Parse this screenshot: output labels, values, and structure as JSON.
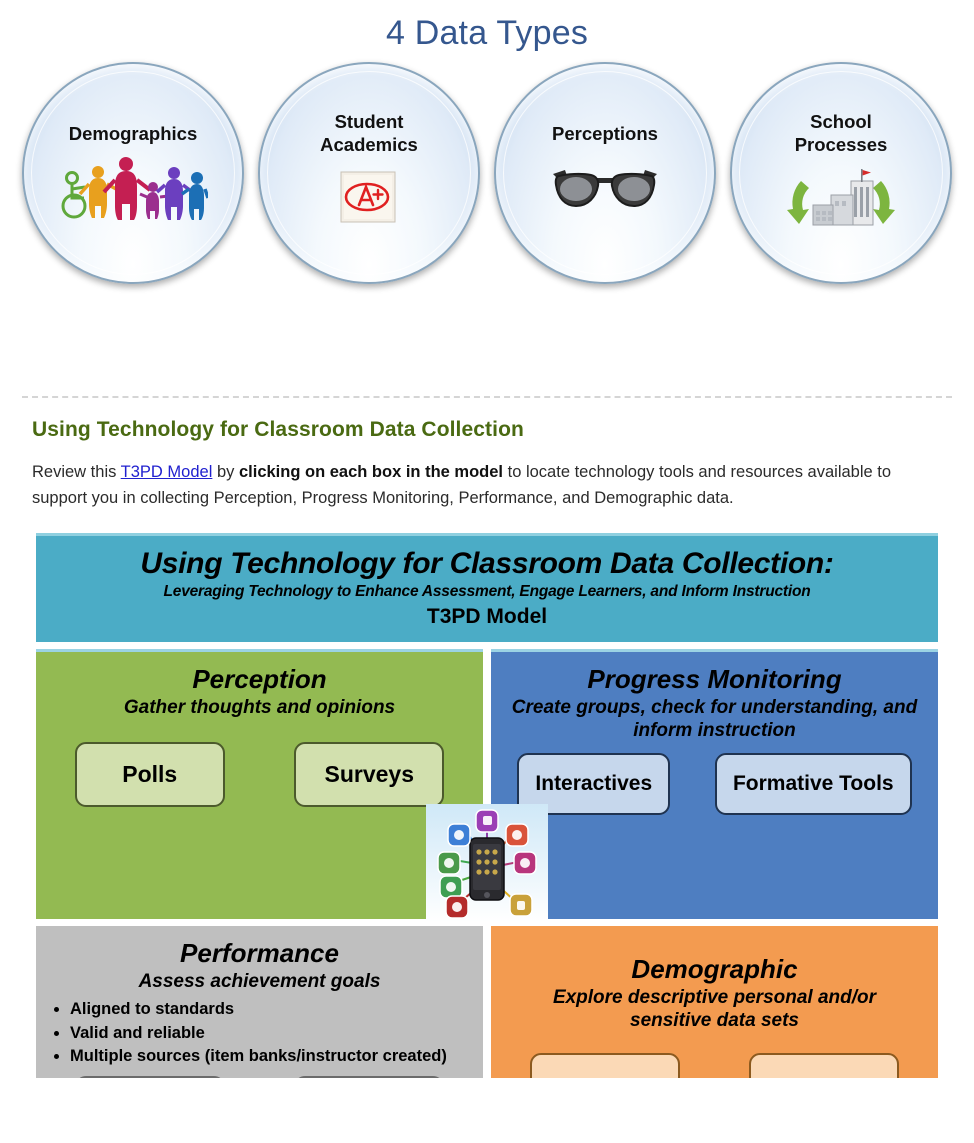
{
  "page": {
    "title": "4 Data Types"
  },
  "data_types": {
    "circles": [
      {
        "label": "Demographics",
        "icon": "diverse-people-icon"
      },
      {
        "label": "Student\nAcademics",
        "label_line1": "Student",
        "label_line2": "Academics",
        "icon": "a-plus-paper-icon"
      },
      {
        "label": "Perceptions",
        "icon": "eyeglasses-icon"
      },
      {
        "label": "School\nProcesses",
        "label_line1": "School",
        "label_line2": "Processes",
        "icon": "school-building-cycle-icon"
      }
    ]
  },
  "section": {
    "heading": "Using Technology for Classroom Data Collection",
    "paragraph_pre": "Review this ",
    "link_text": "T3PD Model",
    "paragraph_mid": " by ",
    "bold_text": "clicking on each box in the model",
    "paragraph_post": " to locate technology tools and resources available to support you in collecting Perception, Progress Monitoring, Performance, and Demographic data."
  },
  "model": {
    "banner": {
      "line1": "Using Technology for Classroom Data Collection:",
      "line2": "Leveraging Technology to Enhance Assessment, Engage Learners, and  Inform Instruction",
      "line3": "T3PD Model"
    },
    "quadrants": [
      {
        "key": "perception",
        "title": "Perception",
        "subtitle": "Gather thoughts and opinions",
        "color": "#93BA52",
        "buttons": [
          "Polls",
          "Surveys"
        ]
      },
      {
        "key": "progress-monitoring",
        "title": "Progress Monitoring",
        "subtitle": "Create groups, check for understanding, and inform instruction",
        "color": "#4E7EC1",
        "buttons": [
          "Interactives",
          "Formative Tools"
        ]
      },
      {
        "key": "performance",
        "title": "Performance",
        "subtitle": "Assess achievement goals",
        "color": "#BFBFBF",
        "bullets": [
          "Aligned to standards",
          "Valid and reliable",
          "Multiple sources (item banks/instructor created)"
        ],
        "buttons": [
          "",
          ""
        ]
      },
      {
        "key": "demographic",
        "title": "Demographic",
        "subtitle": "Explore descriptive personal and/or sensitive data sets",
        "color": "#F39B50",
        "buttons": [
          "",
          ""
        ]
      }
    ],
    "center_icon": "smartphone-apps-icon"
  },
  "colors": {
    "title_blue": "#35578E",
    "heading_green": "#4A6A12",
    "link_blue": "#2020CF",
    "banner_teal": "#4BACC6",
    "perception_green": "#93BA52",
    "progress_blue": "#4E7EC1",
    "performance_grey": "#BFBFBF",
    "demographic_orange": "#F39B50"
  }
}
